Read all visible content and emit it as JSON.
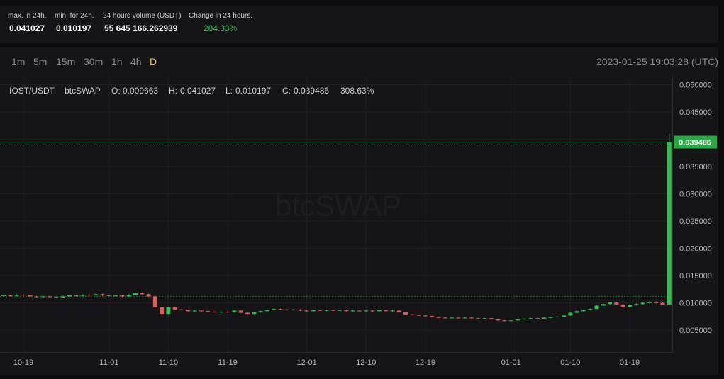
{
  "stats": [
    {
      "label": "max. in 24h.",
      "value": "0.041027"
    },
    {
      "label": "min. for 24h.",
      "value": "0.010197"
    },
    {
      "label": "24 hours volume (USDT)",
      "value": "55 645 166.262939"
    },
    {
      "label": "Change in 24 hours.",
      "value": "284.33%"
    }
  ],
  "timeframes": [
    "1m",
    "5m",
    "15m",
    "30m",
    "1h",
    "4h",
    "D"
  ],
  "active_timeframe": "D",
  "timestamp": "2023-01-25 19:03:28 (UTC)",
  "ohlc": {
    "symbol": "IOST/USDT",
    "exchange": "btcSWAP",
    "o_label": "O:",
    "o": "0.009663",
    "h_label": "H:",
    "h": "0.041027",
    "l_label": "L:",
    "l": "0.010197",
    "c_label": "C:",
    "c": "0.039486",
    "change": "308.63%"
  },
  "watermark": "btcSWAP",
  "colors": {
    "up": "#2fbf4a",
    "down": "#e05a5a",
    "accent": "#f1c24a"
  },
  "chart_data": {
    "type": "candlestick",
    "ylim": [
      0.001,
      0.0515
    ],
    "y_ticks": [
      0.005,
      0.01,
      0.015,
      0.02,
      0.025,
      0.03,
      0.035,
      0.04,
      0.045,
      0.05
    ],
    "y_tick_labels": [
      "0.005000",
      "0.010000",
      "0.015000",
      "0.020000",
      "0.025000",
      "0.030000",
      "0.035000",
      "0.040000",
      "0.045000",
      "0.050000"
    ],
    "x_labels": [
      "10-19",
      "11-01",
      "11-10",
      "11-19",
      "12-01",
      "12-10",
      "12-19",
      "01-01",
      "01-10",
      "01-19"
    ],
    "x_label_dates": [
      "2022-10-19",
      "2022-11-01",
      "2022-11-10",
      "2022-11-19",
      "2022-12-01",
      "2022-12-10",
      "2022-12-19",
      "2023-01-01",
      "2023-01-10",
      "2023-01-19"
    ],
    "current_price": 0.039486,
    "current_price_label": "0.039486",
    "ref_line": 0.0112,
    "candles": [
      {
        "date": "2022-10-16",
        "open": 0.0113,
        "close": 0.0114
      },
      {
        "date": "2022-10-17",
        "open": 0.0114,
        "close": 0.0113
      },
      {
        "date": "2022-10-18",
        "open": 0.0113,
        "close": 0.0115
      },
      {
        "date": "2022-10-19",
        "open": 0.0115,
        "close": 0.0114
      },
      {
        "date": "2022-10-20",
        "open": 0.0114,
        "close": 0.0112
      },
      {
        "date": "2022-10-21",
        "open": 0.0112,
        "close": 0.0111
      },
      {
        "date": "2022-10-22",
        "open": 0.0111,
        "close": 0.0112
      },
      {
        "date": "2022-10-23",
        "open": 0.0112,
        "close": 0.0111
      },
      {
        "date": "2022-10-24",
        "open": 0.0111,
        "close": 0.011
      },
      {
        "date": "2022-10-25",
        "open": 0.011,
        "close": 0.0112
      },
      {
        "date": "2022-10-26",
        "open": 0.0112,
        "close": 0.0114
      },
      {
        "date": "2022-10-27",
        "open": 0.0114,
        "close": 0.0113
      },
      {
        "date": "2022-10-28",
        "open": 0.0113,
        "close": 0.0115
      },
      {
        "date": "2022-10-29",
        "open": 0.0115,
        "close": 0.0114
      },
      {
        "date": "2022-10-30",
        "open": 0.0114,
        "close": 0.0116
      },
      {
        "date": "2022-10-31",
        "open": 0.0116,
        "close": 0.0114
      },
      {
        "date": "2022-11-01",
        "open": 0.0114,
        "close": 0.0113
      },
      {
        "date": "2022-11-02",
        "open": 0.0113,
        "close": 0.0114
      },
      {
        "date": "2022-11-03",
        "open": 0.0114,
        "close": 0.0112
      },
      {
        "date": "2022-11-04",
        "open": 0.0112,
        "close": 0.0115
      },
      {
        "date": "2022-11-05",
        "open": 0.0115,
        "close": 0.0118
      },
      {
        "date": "2022-11-06",
        "open": 0.0118,
        "close": 0.0116
      },
      {
        "date": "2022-11-07",
        "open": 0.0116,
        "close": 0.0112
      },
      {
        "date": "2022-11-08",
        "open": 0.0112,
        "close": 0.0092
      },
      {
        "date": "2022-11-09",
        "open": 0.0092,
        "close": 0.008
      },
      {
        "date": "2022-11-10",
        "open": 0.008,
        "close": 0.0092
      },
      {
        "date": "2022-11-11",
        "open": 0.0092,
        "close": 0.0088
      },
      {
        "date": "2022-11-12",
        "open": 0.0088,
        "close": 0.0087
      },
      {
        "date": "2022-11-13",
        "open": 0.0087,
        "close": 0.0085
      },
      {
        "date": "2022-11-14",
        "open": 0.0085,
        "close": 0.0086
      },
      {
        "date": "2022-11-15",
        "open": 0.0086,
        "close": 0.0085
      },
      {
        "date": "2022-11-16",
        "open": 0.0085,
        "close": 0.0084
      },
      {
        "date": "2022-11-17",
        "open": 0.0084,
        "close": 0.0083
      },
      {
        "date": "2022-11-18",
        "open": 0.0083,
        "close": 0.0084
      },
      {
        "date": "2022-11-19",
        "open": 0.0084,
        "close": 0.0083
      },
      {
        "date": "2022-11-20",
        "open": 0.0083,
        "close": 0.0086
      },
      {
        "date": "2022-11-21",
        "open": 0.0086,
        "close": 0.0082
      },
      {
        "date": "2022-11-22",
        "open": 0.0082,
        "close": 0.008
      },
      {
        "date": "2022-11-23",
        "open": 0.008,
        "close": 0.0083
      },
      {
        "date": "2022-11-24",
        "open": 0.0083,
        "close": 0.0085
      },
      {
        "date": "2022-11-25",
        "open": 0.0085,
        "close": 0.0087
      },
      {
        "date": "2022-11-26",
        "open": 0.0087,
        "close": 0.0089
      },
      {
        "date": "2022-11-27",
        "open": 0.0089,
        "close": 0.0088
      },
      {
        "date": "2022-11-28",
        "open": 0.0088,
        "close": 0.0087
      },
      {
        "date": "2022-11-29",
        "open": 0.0087,
        "close": 0.0088
      },
      {
        "date": "2022-11-30",
        "open": 0.0088,
        "close": 0.0086
      },
      {
        "date": "2022-12-01",
        "open": 0.0086,
        "close": 0.0085
      },
      {
        "date": "2022-12-02",
        "open": 0.0085,
        "close": 0.0087
      },
      {
        "date": "2022-12-03",
        "open": 0.0087,
        "close": 0.0086
      },
      {
        "date": "2022-12-04",
        "open": 0.0086,
        "close": 0.0087
      },
      {
        "date": "2022-12-05",
        "open": 0.0087,
        "close": 0.0086
      },
      {
        "date": "2022-12-06",
        "open": 0.0086,
        "close": 0.0087
      },
      {
        "date": "2022-12-07",
        "open": 0.0087,
        "close": 0.0085
      },
      {
        "date": "2022-12-08",
        "open": 0.0085,
        "close": 0.0086
      },
      {
        "date": "2022-12-09",
        "open": 0.0086,
        "close": 0.0085
      },
      {
        "date": "2022-12-10",
        "open": 0.0085,
        "close": 0.0086
      },
      {
        "date": "2022-12-11",
        "open": 0.0086,
        "close": 0.0085
      },
      {
        "date": "2022-12-12",
        "open": 0.0085,
        "close": 0.0087
      },
      {
        "date": "2022-12-13",
        "open": 0.0087,
        "close": 0.0085
      },
      {
        "date": "2022-12-14",
        "open": 0.0085,
        "close": 0.0086
      },
      {
        "date": "2022-12-15",
        "open": 0.0086,
        "close": 0.0083
      },
      {
        "date": "2022-12-16",
        "open": 0.0083,
        "close": 0.0079
      },
      {
        "date": "2022-12-17",
        "open": 0.0079,
        "close": 0.0078
      },
      {
        "date": "2022-12-18",
        "open": 0.0078,
        "close": 0.0077
      },
      {
        "date": "2022-12-19",
        "open": 0.0077,
        "close": 0.0076
      },
      {
        "date": "2022-12-20",
        "open": 0.0076,
        "close": 0.0074
      },
      {
        "date": "2022-12-21",
        "open": 0.0074,
        "close": 0.0073
      },
      {
        "date": "2022-12-22",
        "open": 0.0073,
        "close": 0.0072
      },
      {
        "date": "2022-12-23",
        "open": 0.0072,
        "close": 0.0073
      },
      {
        "date": "2022-12-24",
        "open": 0.0073,
        "close": 0.0072
      },
      {
        "date": "2022-12-25",
        "open": 0.0072,
        "close": 0.0073
      },
      {
        "date": "2022-12-26",
        "open": 0.0073,
        "close": 0.0072
      },
      {
        "date": "2022-12-27",
        "open": 0.0072,
        "close": 0.0071
      },
      {
        "date": "2022-12-28",
        "open": 0.0071,
        "close": 0.0072
      },
      {
        "date": "2022-12-29",
        "open": 0.0072,
        "close": 0.007
      },
      {
        "date": "2022-12-30",
        "open": 0.007,
        "close": 0.0068
      },
      {
        "date": "2022-12-31",
        "open": 0.0068,
        "close": 0.0067
      },
      {
        "date": "2023-01-01",
        "open": 0.0067,
        "close": 0.0068
      },
      {
        "date": "2023-01-02",
        "open": 0.0068,
        "close": 0.007
      },
      {
        "date": "2023-01-03",
        "open": 0.007,
        "close": 0.0071
      },
      {
        "date": "2023-01-04",
        "open": 0.0071,
        "close": 0.0072
      },
      {
        "date": "2023-01-05",
        "open": 0.0072,
        "close": 0.0071
      },
      {
        "date": "2023-01-06",
        "open": 0.0071,
        "close": 0.0073
      },
      {
        "date": "2023-01-07",
        "open": 0.0073,
        "close": 0.0074
      },
      {
        "date": "2023-01-08",
        "open": 0.0074,
        "close": 0.0075
      },
      {
        "date": "2023-01-09",
        "open": 0.0075,
        "close": 0.0077
      },
      {
        "date": "2023-01-10",
        "open": 0.0077,
        "close": 0.0082
      },
      {
        "date": "2023-01-11",
        "open": 0.0082,
        "close": 0.0085
      },
      {
        "date": "2023-01-12",
        "open": 0.0085,
        "close": 0.0087
      },
      {
        "date": "2023-01-13",
        "open": 0.0087,
        "close": 0.0089
      },
      {
        "date": "2023-01-14",
        "open": 0.0089,
        "close": 0.0095
      },
      {
        "date": "2023-01-15",
        "open": 0.0095,
        "close": 0.0098
      },
      {
        "date": "2023-01-16",
        "open": 0.0098,
        "close": 0.0101
      },
      {
        "date": "2023-01-17",
        "open": 0.0101,
        "close": 0.0097
      },
      {
        "date": "2023-01-18",
        "open": 0.0097,
        "close": 0.0093
      },
      {
        "date": "2023-01-19",
        "open": 0.0093,
        "close": 0.0096
      },
      {
        "date": "2023-01-20",
        "open": 0.0096,
        "close": 0.0098
      },
      {
        "date": "2023-01-21",
        "open": 0.0098,
        "close": 0.01
      },
      {
        "date": "2023-01-22",
        "open": 0.01,
        "close": 0.0102
      },
      {
        "date": "2023-01-23",
        "open": 0.0102,
        "close": 0.01
      },
      {
        "date": "2023-01-24",
        "open": 0.01,
        "close": 0.0097
      },
      {
        "date": "2023-01-25",
        "open": 0.009663,
        "high": 0.041027,
        "low": 0.010197,
        "close": 0.039486
      }
    ]
  }
}
